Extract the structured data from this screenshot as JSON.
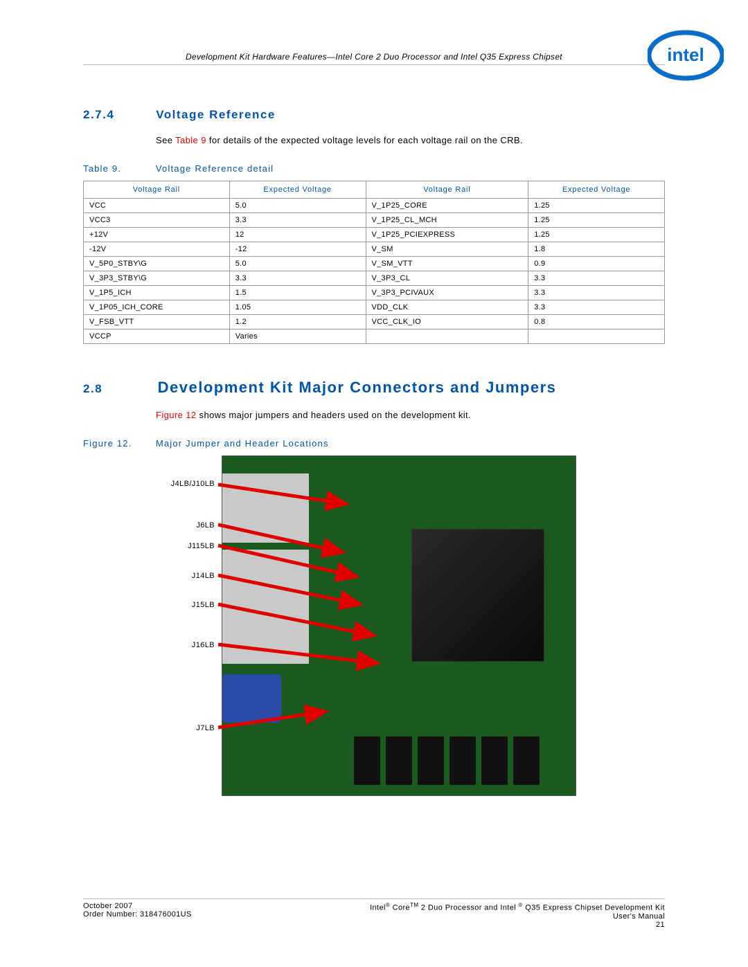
{
  "header": "Development Kit Hardware Features—Intel Core 2 Duo Processor and Intel Q35 Express Chipset",
  "logo_name": "intel",
  "s274": {
    "num": "2.7.4",
    "title": "Voltage Reference"
  },
  "s274_text_pre": "See ",
  "s274_text_link": "Table 9",
  "s274_text_post": " for details of the expected voltage levels for each voltage rail on the CRB.",
  "table9": {
    "caption_label": "Table 9.",
    "caption_title": "Voltage Reference detail",
    "headers": [
      "Voltage Rail",
      "Expected Voltage",
      "Voltage Rail",
      "Expected Voltage"
    ],
    "rows": [
      [
        "VCC",
        "5.0",
        "V_1P25_CORE",
        "1.25"
      ],
      [
        "VCC3",
        "3.3",
        "V_1P25_CL_MCH",
        "1.25"
      ],
      [
        "+12V",
        "12",
        "V_1P25_PCIEXPRESS",
        "1.25"
      ],
      [
        "-12V",
        "-12",
        "V_SM",
        "1.8"
      ],
      [
        "V_5P0_STBY\\G",
        "5.0",
        "V_SM_VTT",
        "0.9"
      ],
      [
        "V_3P3_STBY\\G",
        "3.3",
        "V_3P3_CL",
        "3.3"
      ],
      [
        "V_1P5_ICH",
        "1.5",
        "V_3P3_PCIVAUX",
        "3.3"
      ],
      [
        "V_1P05_ICH_CORE",
        "1.05",
        "VDD_CLK",
        "3.3"
      ],
      [
        "V_FSB_VTT",
        "1.2",
        "VCC_CLK_IO",
        "0.8"
      ],
      [
        "VCCP",
        "Varies",
        "",
        ""
      ]
    ]
  },
  "s28": {
    "num": "2.8",
    "title": "Development Kit Major Connectors and Jumpers"
  },
  "s28_text_link": "Figure 12",
  "s28_text_post": " shows major jumpers and headers used on the development kit.",
  "fig12": {
    "caption_label": "Figure 12.",
    "caption_title": "Major Jumper and Header Locations",
    "labels": [
      "J4LB/J10LB",
      "J6LB",
      "J115LB",
      "J14LB",
      "J15LB",
      "J16LB",
      "J7LB"
    ]
  },
  "footer": {
    "left1": "October 2007",
    "left2": "Order Number: 318476001US",
    "right1_a": "Intel",
    "right1_b": " Core",
    "right1_c": " 2 Duo Processor and Intel ",
    "right1_d": " Q35 Express Chipset Development Kit",
    "right2": "User's Manual",
    "right3": "21"
  }
}
